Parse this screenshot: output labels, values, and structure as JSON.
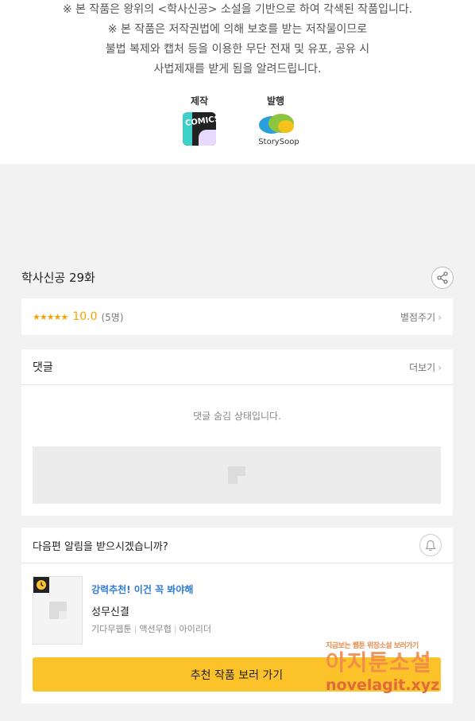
{
  "notice": {
    "lines": [
      "※ 본 작품은 왕위의 <학사신공> 소설을 기반으로 하여 각색된 작품입니다.",
      "※ 본 작품은 저작권법에 의해 보호를 받는 저작물이므로",
      "불법 복제와 캡처 등을 이용한 무단 전재 및 유포, 공유 시",
      "사법제재를 받게 됨을 알려드립니다."
    ],
    "production_label": "제작",
    "publisher_label": "발행",
    "publisher_logo_text": "StorySoop",
    "production_logo_text": "COMICS"
  },
  "episode": {
    "title": "학사신공 29화"
  },
  "rating": {
    "stars": "★★★★★",
    "score": "10.0",
    "count": "(5명)",
    "rate_label": "별점주기"
  },
  "comments": {
    "title": "댓글",
    "more_label": "더보기",
    "hidden_message": "댓글 숨김 상태입니다."
  },
  "next_alert": {
    "question": "다음편 알림을 받으시겠습니까?",
    "recommend_tag": "강력추천! 이건 꼭 봐야해",
    "recommend_title": "성무신결",
    "genres": [
      "기다무웹툰",
      "액션무협",
      "아이리더"
    ],
    "button_label": "추천 작품 보러 가기"
  },
  "watermark": {
    "top": "지금보는 웹툰 위장소설 보러가기",
    "mid": "아지툰소설",
    "bottom": "novelagit.xyz"
  },
  "colors": {
    "accent_yellow": "#fcc229",
    "star_orange": "#f5a300",
    "link_blue": "#2e7bd6"
  }
}
